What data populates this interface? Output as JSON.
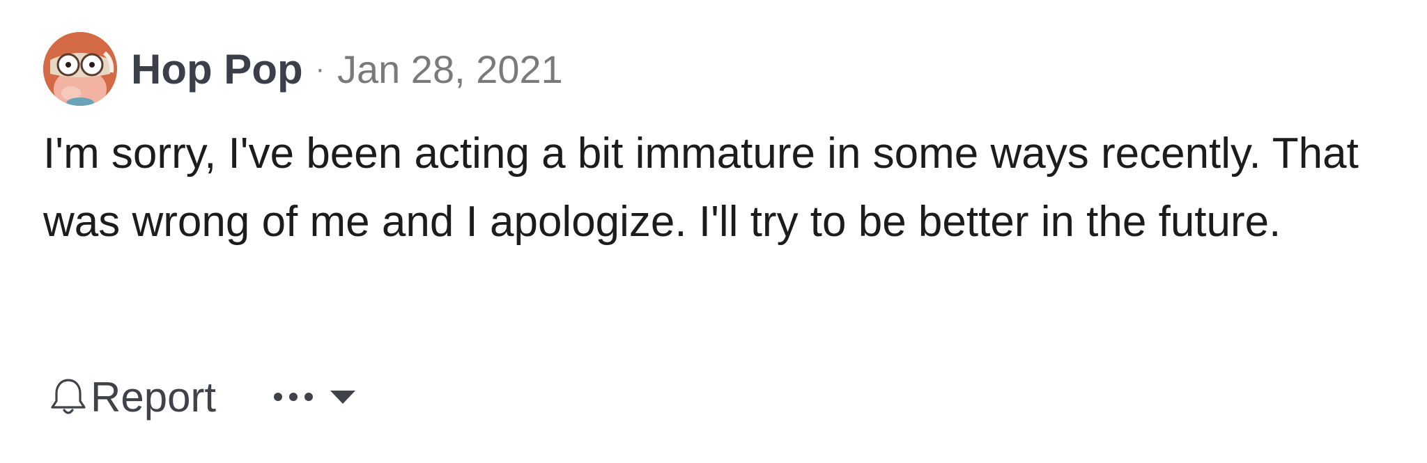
{
  "comment": {
    "author": "Hop Pop",
    "separator": "·",
    "timestamp": "Jan 28, 2021",
    "body": "I'm sorry, I've been acting a bit immature in some ways recently. That was wrong of me and I apologize. I'll try to be better in the future.",
    "avatar_icon": "cartoon-avatar-icon"
  },
  "actions": {
    "report_label": "Report",
    "report_icon": "bell-icon",
    "more_icon": "ellipsis-icon",
    "dropdown_icon": "caret-down-icon"
  },
  "colors": {
    "author": "#3a3f4a",
    "timestamp": "#7a7a7a",
    "body": "#1c1c1c",
    "action": "#3f4248"
  }
}
